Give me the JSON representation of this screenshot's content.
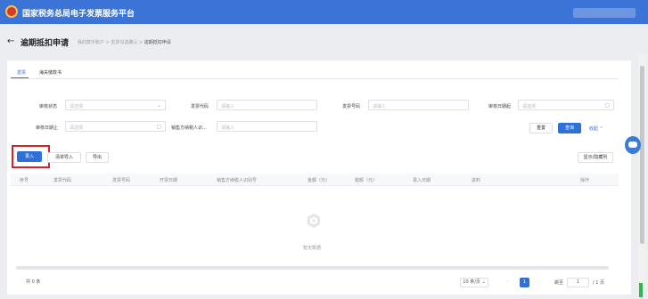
{
  "header": {
    "app_title": "国家税务总局电子发票服务平台"
  },
  "page": {
    "title": "逾期抵扣申请",
    "breadcrumb": [
      "我的数字账户",
      "发票勾选确认",
      "逾期抵扣申请"
    ]
  },
  "tabs": [
    {
      "label": "发票",
      "active": true
    },
    {
      "label": "海关缴款书",
      "active": false
    }
  ],
  "filters": {
    "audit_status": {
      "label": "审核状态",
      "placeholder": "请选择"
    },
    "invoice_code": {
      "label": "发票代码",
      "placeholder": "请输入"
    },
    "invoice_number": {
      "label": "发票号码",
      "placeholder": "请输入"
    },
    "audit_date_from": {
      "label": "审核日期起",
      "placeholder": "请选择"
    },
    "audit_date_to": {
      "label": "审核日期止",
      "placeholder": "请选择"
    },
    "seller_tax_id": {
      "label": "销售方纳税人识...",
      "placeholder": "请输入"
    }
  },
  "actions": {
    "reset": "重置",
    "query": "查询",
    "collapse": "收起"
  },
  "toolbar": {
    "entry": "录入",
    "list_import": "清单导入",
    "export": "导出",
    "show_hide_columns": "显示/隐藏列"
  },
  "table": {
    "columns": [
      "序号",
      "发票代码",
      "发票号码",
      "开票日期",
      "销售方纳税人识别号",
      "金额（元）",
      "税额（元）",
      "录入日期",
      "进料",
      "操作"
    ],
    "empty_text": "暂无数据"
  },
  "pagination": {
    "total": "共 0 条",
    "page_size": "10 条/页",
    "current_page": "1",
    "goto_label": "跳至",
    "goto_value": "1",
    "page_suffix": "/ 1 页"
  },
  "colors": {
    "brand": "#3b73d6",
    "primary": "#2f6fd8",
    "highlight": "#d2232a"
  },
  "icons": [
    "back-arrow-icon",
    "chevron-down-icon",
    "calendar-icon",
    "chevron-up-icon",
    "empty-box-icon",
    "chevron-left-icon",
    "chevron-right-icon",
    "assistant-robot-icon"
  ]
}
